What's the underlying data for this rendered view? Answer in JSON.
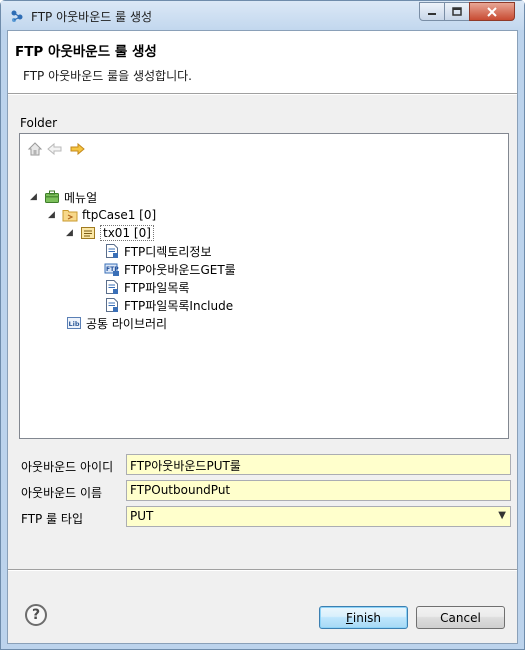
{
  "window": {
    "title": "FTP 아웃바운드 룰 생성"
  },
  "header": {
    "title": "FTP 아웃바운드 룰 생성",
    "description": "FTP 아웃바운드 룰을 생성합니다."
  },
  "folder": {
    "label": "Folder",
    "toolbar": [
      "home-icon",
      "back-arrow-icon",
      "forward-arrow-icon"
    ],
    "tree": {
      "root": {
        "label": "메뉴얼",
        "icon": "briefcase-icon",
        "expanded": true
      },
      "case": {
        "label": "ftpCase1 [0]",
        "icon": "folder-case-icon",
        "expanded": true
      },
      "tx": {
        "label": "tx01 [0]",
        "icon": "transaction-icon",
        "expanded": true,
        "selected": true
      },
      "leaves": [
        {
          "label": "FTP디렉토리정보",
          "icon": "document-icon"
        },
        {
          "label": "FTP아웃바운드GET룰",
          "icon": "ftp-rule-icon"
        },
        {
          "label": "FTP파일목록",
          "icon": "document-icon"
        },
        {
          "label": "FTP파일목록Include",
          "icon": "document-icon"
        }
      ],
      "library": {
        "label": "공통 라이브러리",
        "icon": "library-icon"
      }
    }
  },
  "form": {
    "outbound_id": {
      "label": "아웃바운드 아이디",
      "value": "FTP아웃바운드PUT룰"
    },
    "outbound_name": {
      "label": "아웃바운드 이름",
      "value": "FTPOutboundPut"
    },
    "rule_type": {
      "label": "FTP 룰 타입",
      "value": "PUT"
    }
  },
  "buttons": {
    "finish_first": "F",
    "finish_rest": "inish",
    "cancel": "Cancel",
    "help": "?"
  },
  "colors": {
    "field_bg": "#ffffcc",
    "window_frame": "#bcd3ec"
  }
}
